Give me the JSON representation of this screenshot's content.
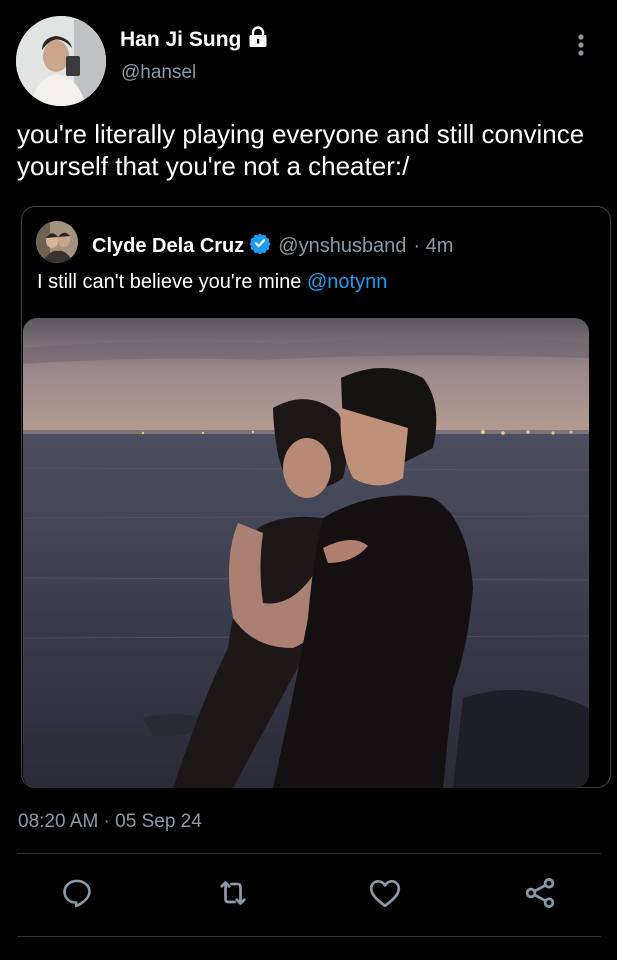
{
  "tweet": {
    "author": {
      "name": "Han Ji Sung",
      "handle": "@hansel",
      "locked": true
    },
    "text": "you're literally playing everyone and still convince yourself that you're not a cheater:/",
    "timestamp": "08:20 AM · 05 Sep 24"
  },
  "quote": {
    "author": {
      "name": "Clyde Dela Cruz",
      "handle": "@ynshusband",
      "time_ago": "· 4m",
      "verified": true
    },
    "text": "I still can't believe you're mine",
    "mention": "@notynn"
  },
  "icons": {
    "more": "more-vertical-icon",
    "lock": "lock-icon",
    "verified": "verified-badge-icon",
    "reply": "reply-icon",
    "retweet": "retweet-icon",
    "like": "like-icon",
    "share": "share-icon"
  },
  "colors": {
    "background": "#000000",
    "text": "#ffffff",
    "secondary_text": "#8b98a5",
    "link": "#1d9bf0",
    "border": "#3e4144"
  }
}
